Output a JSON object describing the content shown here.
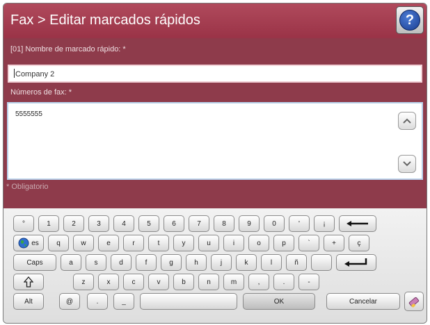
{
  "header": {
    "title": "Fax > Editar marcados rápidos",
    "help_label": "?"
  },
  "form": {
    "name_label": "[01] Nombre de marcado rápido: *",
    "name_value": "Company 2",
    "fax_label": "Números de fax: *",
    "fax_value": "5555555",
    "required_note": "* Obligatorio"
  },
  "keyboard": {
    "row1": [
      "°",
      "1",
      "2",
      "3",
      "4",
      "5",
      "6",
      "7",
      "8",
      "9",
      "0",
      "'",
      "¡"
    ],
    "row2": [
      "q",
      "w",
      "e",
      "r",
      "t",
      "y",
      "u",
      "i",
      "o",
      "p",
      "`",
      "+",
      "ç"
    ],
    "row3": [
      "a",
      "s",
      "d",
      "f",
      "g",
      "h",
      "j",
      "k",
      "l",
      "ñ",
      ""
    ],
    "row4": [
      "z",
      "x",
      "c",
      "v",
      "b",
      "n",
      "m",
      ",",
      ".",
      "-"
    ],
    "lang_label": "es",
    "caps_label": "Caps",
    "alt_label": "Alt",
    "at_label": "@",
    "dot_label": ".",
    "underscore_label": "_",
    "ok_label": "OK",
    "cancel_label": "Cancelar"
  },
  "colors": {
    "title_bar": "#9a3347",
    "form_background": "#8e3b4b",
    "keyboard_background": "#e6e6e6"
  }
}
